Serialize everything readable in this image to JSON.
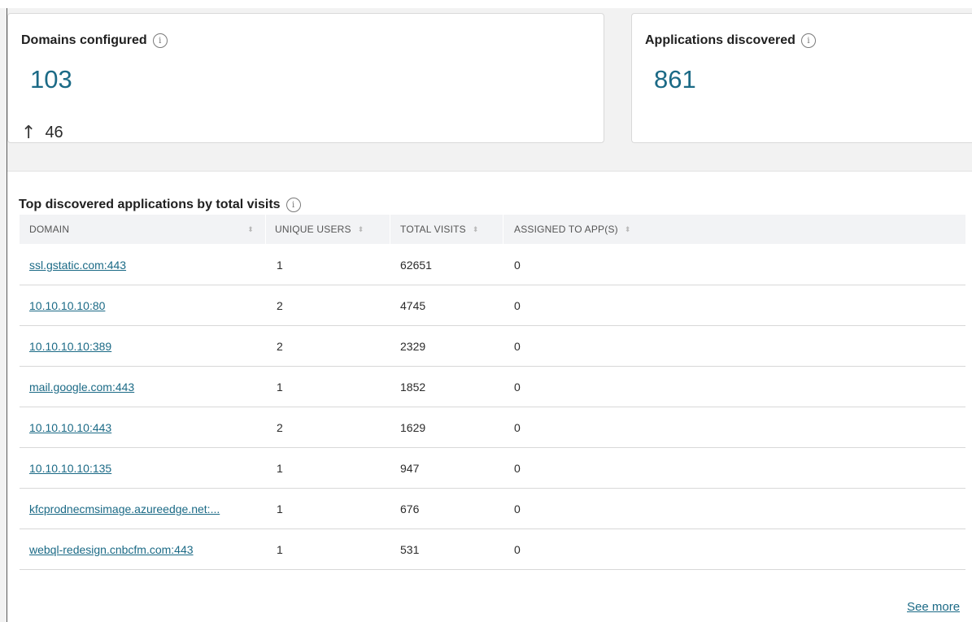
{
  "cards": {
    "domains": {
      "title": "Domains configured",
      "value": "103",
      "delta": "46"
    },
    "apps": {
      "title": "Applications discovered",
      "value": "861"
    }
  },
  "table": {
    "title": "Top discovered applications by total visits",
    "columns": [
      "DOMAIN",
      "UNIQUE USERS",
      "TOTAL VISITS",
      "ASSIGNED TO APP(S)"
    ],
    "rows": [
      {
        "domain": "ssl.gstatic.com:443",
        "users": "1",
        "visits": "62651",
        "assigned": "0"
      },
      {
        "domain": "10.10.10.10:80",
        "users": "2",
        "visits": "4745",
        "assigned": "0"
      },
      {
        "domain": "10.10.10.10:389",
        "users": "2",
        "visits": "2329",
        "assigned": "0"
      },
      {
        "domain": "mail.google.com:443",
        "users": "1",
        "visits": "1852",
        "assigned": "0"
      },
      {
        "domain": "10.10.10.10:443",
        "users": "2",
        "visits": "1629",
        "assigned": "0"
      },
      {
        "domain": "10.10.10.10:135",
        "users": "1",
        "visits": "947",
        "assigned": "0"
      },
      {
        "domain": "kfcprodnecmsimage.azureedge.net:...",
        "users": "1",
        "visits": "676",
        "assigned": "0"
      },
      {
        "domain": "webql-redesign.cnbcfm.com:443",
        "users": "1",
        "visits": "531",
        "assigned": "0"
      }
    ],
    "see_more": "See more"
  },
  "icons": {
    "info": "info-icon",
    "arrow": "arrow-up-icon",
    "sort": "sort-icon"
  },
  "colors": {
    "accent": "#1b6a86",
    "background": "#f2f2f2",
    "header_bg": "#f2f3f5"
  }
}
